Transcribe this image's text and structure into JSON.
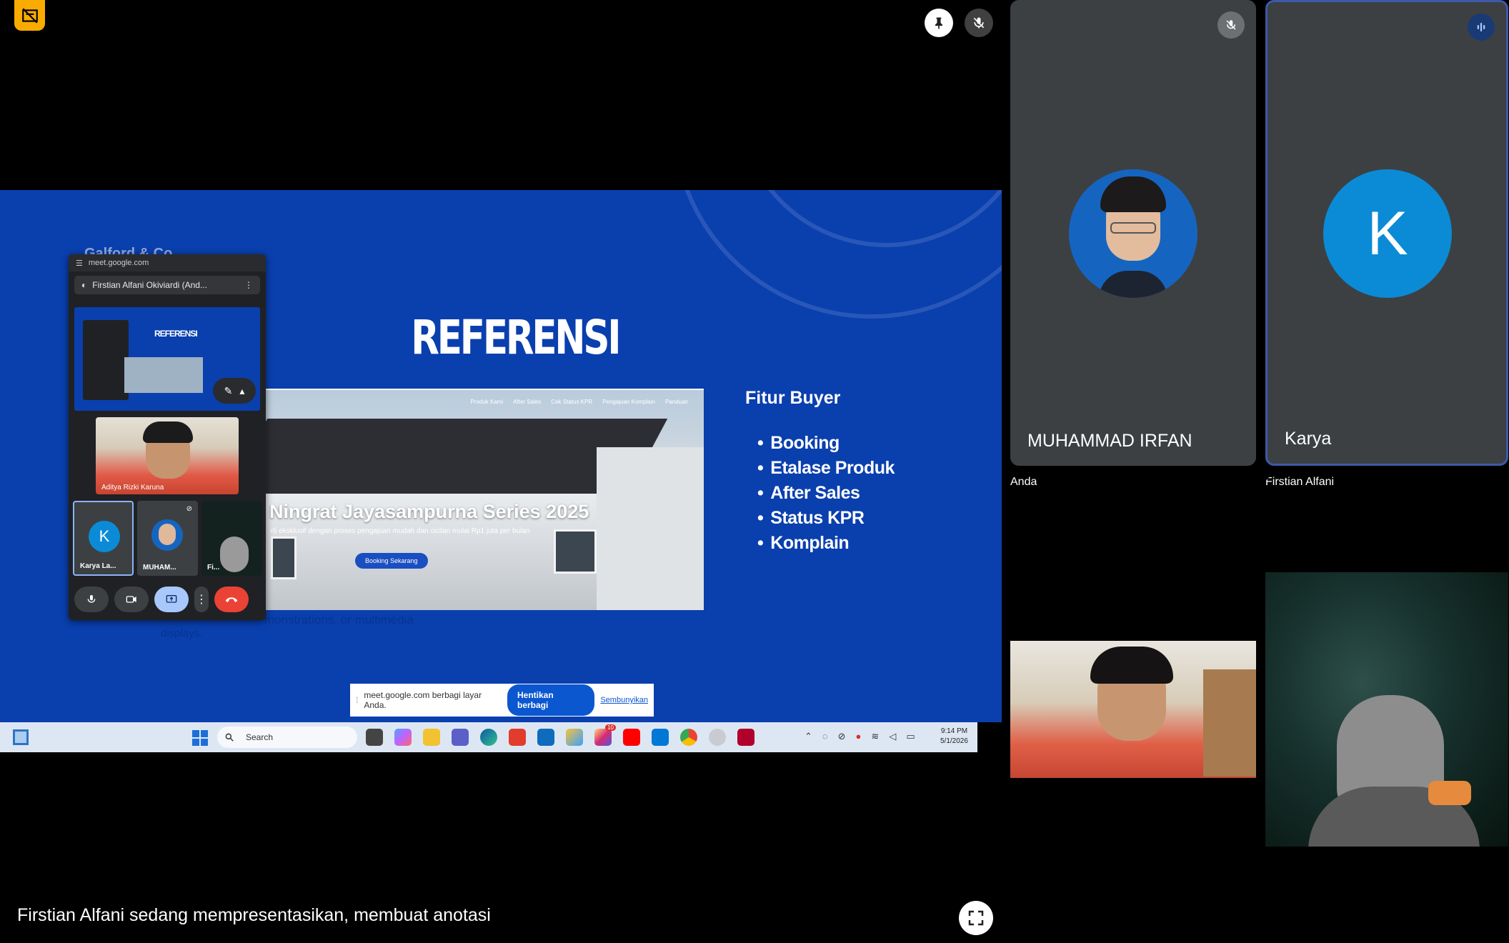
{
  "presentation": {
    "caption": "Firstian Alfani sedang mempresentasikan, membuat anotasi",
    "slide": {
      "title": "REFERENSI",
      "hero_heading": "Ningrat Jayasampurna Series 2025",
      "hero_sub": "rti eksklusif dengan proses pengajuan mudah dan cicilan mulai Rp1 juta per bulan",
      "hero_button": "Booking Sekarang",
      "hero_nav": [
        "Produk Kami",
        "After Sales",
        "Cek Status KPR",
        "Pengajuan Komplain",
        "Panduan"
      ],
      "fitur_title": "Fitur Buyer",
      "fitur_items": [
        "Booking",
        "Etalase Produk",
        "After Sales",
        "Status KPR",
        "Komplain"
      ],
      "ghost_brand": "Galford & Co",
      "ghost_line": "monstrations,   or   multimedia",
      "ghost_line2": "displays."
    },
    "share_bar": {
      "message": "meet.google.com berbagi layar Anda.",
      "stop_label": "Hentikan berbagi",
      "hide_label": "Sembunyikan"
    },
    "taskbar": {
      "search_placeholder": "Search",
      "time": "9:14 PM",
      "date": "5/1/2026",
      "notification_badge": "10"
    },
    "pip": {
      "url": "meet.google.com",
      "tab_title": "Firstian Alfani Okiviardi (And...",
      "mini_title": "REFERENSI",
      "camera_label": "Aditya Rizki Karuna",
      "tiles": [
        {
          "label": "Karya La...",
          "initial": "K"
        },
        {
          "label": "MUHAM..."
        },
        {
          "label": "Fi..."
        }
      ]
    }
  },
  "participants": [
    {
      "name": "MUHAMMAD IRFAN",
      "muted": true
    },
    {
      "name": "Karya",
      "initial": "K",
      "speaking": true
    },
    {
      "name": "Anda"
    },
    {
      "name": "Firstian Alfani"
    }
  ],
  "colors": {
    "slide_blue": "#0a3fae",
    "accent_yellow": "#f9ab00",
    "tile_gray": "#3c4043",
    "avatar_blue": "#0b8bd6",
    "stop_share_blue": "#0b57d0",
    "end_call_red": "#ea4335"
  },
  "icons": {
    "corner": "no-recording-icon",
    "pin": "pin-icon",
    "mic_off": "mic-off-icon",
    "speaking": "audio-level-icon",
    "fullscreen": "fullscreen-icon"
  }
}
